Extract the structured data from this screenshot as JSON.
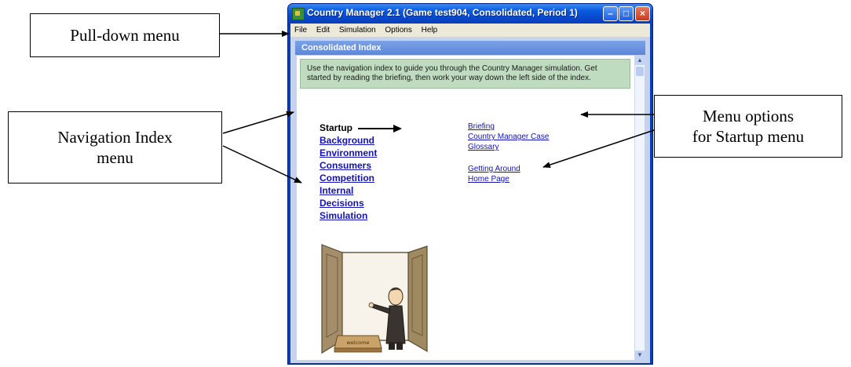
{
  "callouts": {
    "pulldown": "Pull-down menu",
    "nav_line1": "Navigation Index",
    "nav_line2": "menu",
    "options_line1": "Menu options",
    "options_line2": "for Startup menu"
  },
  "window": {
    "title": "Country Manager 2.1 (Game test904, Consolidated, Period 1)",
    "controls": {
      "minimize": "–",
      "maximize": "□",
      "close": "×"
    }
  },
  "menubar": [
    "File",
    "Edit",
    "Simulation",
    "Options",
    "Help"
  ],
  "panel": {
    "header": "Consolidated Index",
    "intro": "Use the navigation index to guide you through the Country Manager simulation. Get started by reading the briefing, then work your way down the left side of the index."
  },
  "nav_index": [
    "Startup",
    "Background",
    "Environment",
    "Consumers",
    "Competition",
    "Internal",
    "Decisions",
    "Simulation"
  ],
  "startup_options": [
    "Briefing",
    "Country Manager Case",
    "Glossary",
    "Getting Around",
    "Home Page"
  ],
  "illustration": {
    "mat_text": "welcome"
  },
  "colors": {
    "title_bar": "#0a5ae0",
    "link": "#1111bb",
    "intro_bg": "#c0dcc0",
    "client_bg": "#c5d3ee"
  }
}
